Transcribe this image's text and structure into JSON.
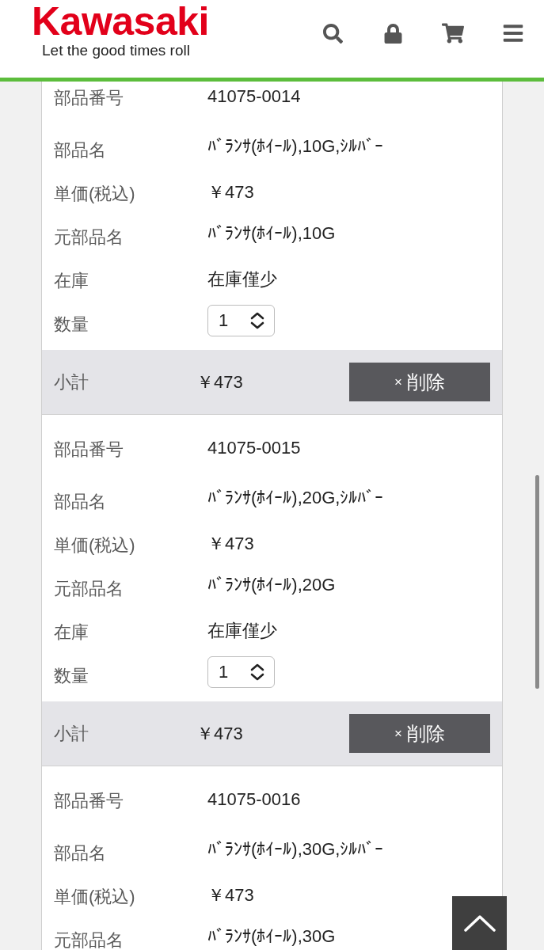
{
  "header": {
    "logo": "Kawasaki",
    "tagline": "Let the good times roll"
  },
  "items": [
    {
      "fields": [
        {
          "label": "部品番号",
          "value": "41075-0014"
        },
        {
          "label": "部品名",
          "value": "ﾊﾞﾗﾝｻ(ﾎｲｰﾙ),10G,ｼﾙﾊﾞｰ"
        },
        {
          "label": "単価(税込)",
          "value": "￥473"
        },
        {
          "label": "元部品名",
          "value": "ﾊﾞﾗﾝｻ(ﾎｲｰﾙ),10G"
        },
        {
          "label": "在庫",
          "value": "在庫僅少"
        }
      ],
      "quantity": {
        "label": "数量",
        "value": "1"
      },
      "subtotal": {
        "label": "小計",
        "value": "￥473"
      },
      "delete_button": {
        "mark": "×",
        "label": "削除"
      }
    },
    {
      "fields": [
        {
          "label": "部品番号",
          "value": "41075-0015"
        },
        {
          "label": "部品名",
          "value": "ﾊﾞﾗﾝｻ(ﾎｲｰﾙ),20G,ｼﾙﾊﾞｰ"
        },
        {
          "label": "単価(税込)",
          "value": "￥473"
        },
        {
          "label": "元部品名",
          "value": "ﾊﾞﾗﾝｻ(ﾎｲｰﾙ),20G"
        },
        {
          "label": "在庫",
          "value": "在庫僅少"
        }
      ],
      "quantity": {
        "label": "数量",
        "value": "1"
      },
      "subtotal": {
        "label": "小計",
        "value": "￥473"
      },
      "delete_button": {
        "mark": "×",
        "label": "削除"
      }
    },
    {
      "fields": [
        {
          "label": "部品番号",
          "value": "41075-0016"
        },
        {
          "label": "部品名",
          "value": "ﾊﾞﾗﾝｻ(ﾎｲｰﾙ),30G,ｼﾙﾊﾞｰ"
        },
        {
          "label": "単価(税込)",
          "value": "￥473"
        },
        {
          "label": "元部品名",
          "value": "ﾊﾞﾗﾝｻ(ﾎｲｰﾙ),30G"
        }
      ]
    }
  ]
}
